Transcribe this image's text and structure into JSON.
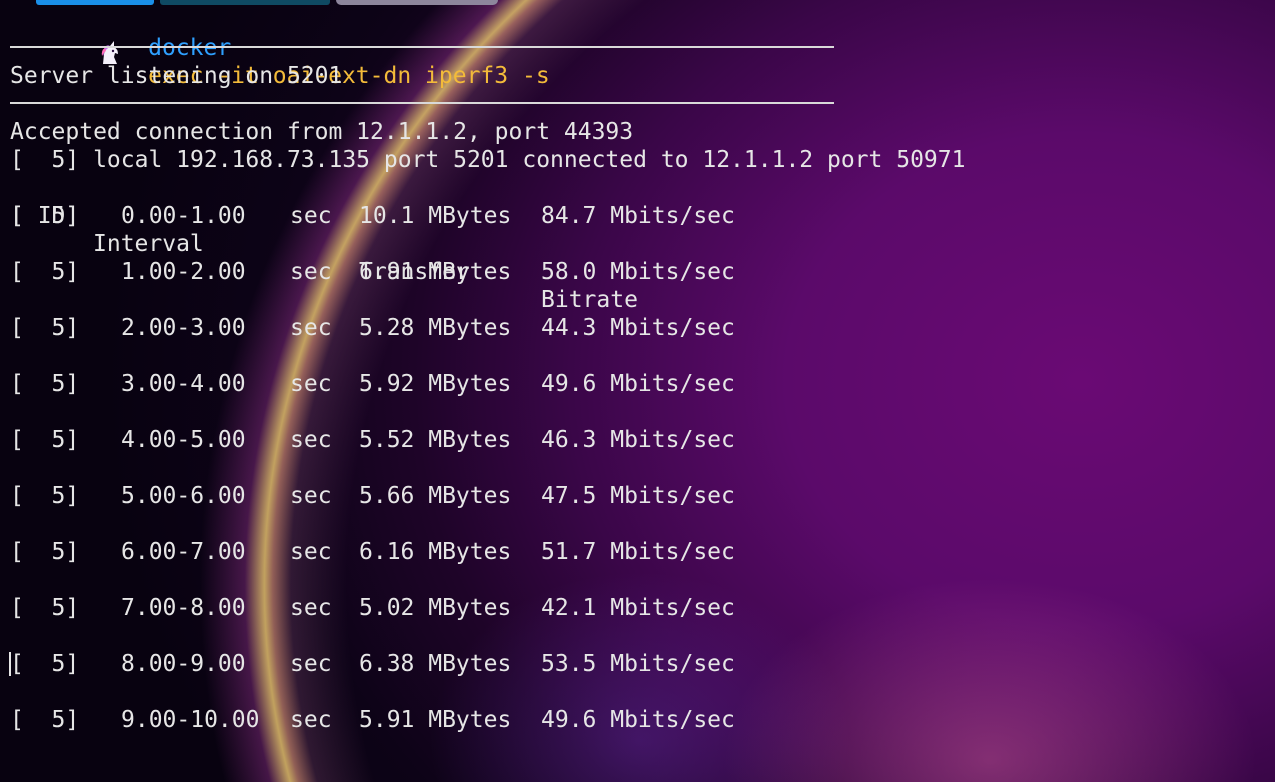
{
  "window": {
    "tabs": [
      {
        "name": "tab-1",
        "active": true,
        "color": "#1a8fe8"
      },
      {
        "name": "tab-2",
        "active": false,
        "color": "#0f4a63"
      },
      {
        "name": "tab-3",
        "active": false,
        "color": "#8d869c"
      }
    ]
  },
  "prompt": {
    "icon": "unicorn-icon",
    "command": "docker",
    "args": "exec -it oai-ext-dn iperf3 -s",
    "command_color": "#2ea0ff",
    "args_color": "#f3bb3a"
  },
  "output": {
    "listening": "Server listening on 5201",
    "accepted": "Accepted connection from 12.1.1.2, port 44393",
    "local": "[  5] local 192.168.73.135 port 5201 connected to 12.1.1.2 port 50971",
    "header": {
      "id": "[ ID]",
      "interval": "Interval",
      "transfer": "Transfer",
      "bitrate": "Bitrate"
    },
    "rows": [
      {
        "id": "[  5]",
        "interval": "0.00-1.00",
        "unit": "sec",
        "transfer": "10.1 MBytes",
        "bitrate": "84.7 Mbits/sec"
      },
      {
        "id": "[  5]",
        "interval": "1.00-2.00",
        "unit": "sec",
        "transfer": "6.91 MBytes",
        "bitrate": "58.0 Mbits/sec"
      },
      {
        "id": "[  5]",
        "interval": "2.00-3.00",
        "unit": "sec",
        "transfer": "5.28 MBytes",
        "bitrate": "44.3 Mbits/sec"
      },
      {
        "id": "[  5]",
        "interval": "3.00-4.00",
        "unit": "sec",
        "transfer": "5.92 MBytes",
        "bitrate": "49.6 Mbits/sec"
      },
      {
        "id": "[  5]",
        "interval": "4.00-5.00",
        "unit": "sec",
        "transfer": "5.52 MBytes",
        "bitrate": "46.3 Mbits/sec"
      },
      {
        "id": "[  5]",
        "interval": "5.00-6.00",
        "unit": "sec",
        "transfer": "5.66 MBytes",
        "bitrate": "47.5 Mbits/sec"
      },
      {
        "id": "[  5]",
        "interval": "6.00-7.00",
        "unit": "sec",
        "transfer": "6.16 MBytes",
        "bitrate": "51.7 Mbits/sec"
      },
      {
        "id": "[  5]",
        "interval": "7.00-8.00",
        "unit": "sec",
        "transfer": "5.02 MBytes",
        "bitrate": "42.1 Mbits/sec"
      },
      {
        "id": "[  5]",
        "interval": "8.00-9.00",
        "unit": "sec",
        "transfer": "6.38 MBytes",
        "bitrate": "53.5 Mbits/sec"
      },
      {
        "id": "[  5]",
        "interval": "9.00-10.00",
        "unit": "sec",
        "transfer": "5.91 MBytes",
        "bitrate": "49.6 Mbits/sec"
      }
    ]
  }
}
